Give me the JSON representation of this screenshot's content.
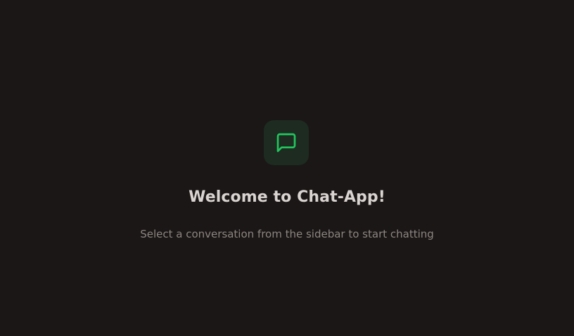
{
  "welcome": {
    "icon": "chat-bubble-icon",
    "title": "Welcome to Chat-App!",
    "subtitle": "Select a conversation from the sidebar to start chatting"
  },
  "colors": {
    "background": "#1b1716",
    "accent": "#22c55e",
    "icon_tile": "#1d2b21",
    "title_text": "#d9d4d1",
    "subtitle_text": "#8c8582"
  }
}
